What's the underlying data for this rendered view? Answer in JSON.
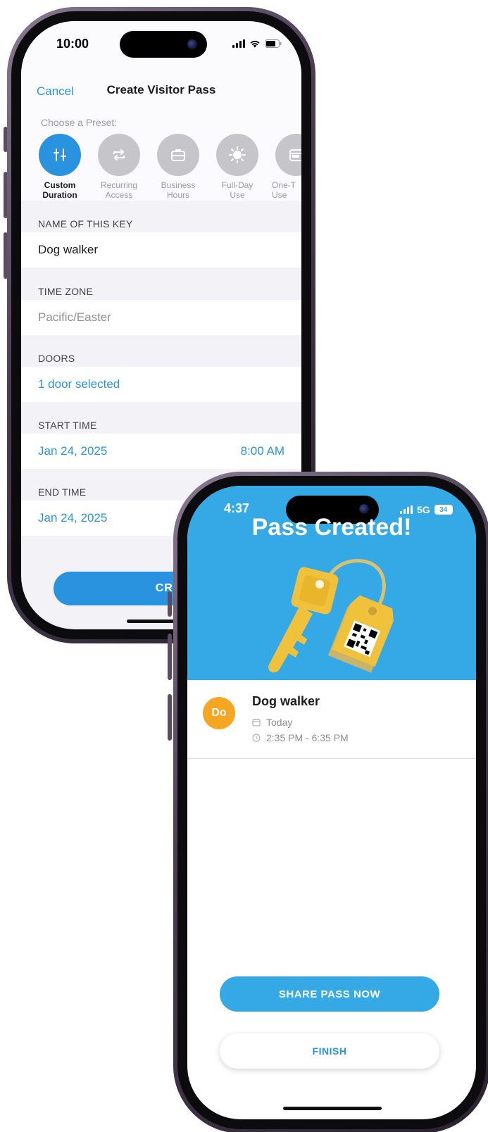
{
  "phone1": {
    "status": {
      "time": "10:00"
    },
    "nav": {
      "cancel": "Cancel",
      "title": "Create Visitor Pass"
    },
    "preset_label": "Choose a Preset:",
    "presets": [
      {
        "label": "Custom\nDuration",
        "icon": "sliders-icon",
        "active": true
      },
      {
        "label": "Recurring\nAccess",
        "icon": "repeat-icon",
        "active": false
      },
      {
        "label": "Business\nHours",
        "icon": "briefcase-icon",
        "active": false
      },
      {
        "label": "Full-Day\nUse",
        "icon": "sun-icon",
        "active": false
      },
      {
        "label": "One-T\nUse",
        "icon": "calendar-icon",
        "active": false
      }
    ],
    "sections": {
      "name_header": "NAME OF THIS KEY",
      "name_value": "Dog walker",
      "tz_header": "TIME ZONE",
      "tz_value": "Pacific/Easter",
      "doors_header": "DOORS",
      "doors_value": "1 door selected",
      "start_header": "START TIME",
      "start_date": "Jan 24, 2025",
      "start_time": "8:00 AM",
      "end_header": "END TIME",
      "end_date": "Jan 24, 2025"
    },
    "create_button": "CREATE"
  },
  "phone2": {
    "status": {
      "time": "4:37",
      "network": "5G",
      "battery": "34"
    },
    "title": "Pass Created!",
    "pass": {
      "avatar": "Do",
      "name": "Dog walker",
      "date": "Today",
      "time_range": "2:35 PM - 6:35 PM"
    },
    "share_button": "SHARE PASS NOW",
    "finish_button": "FINISH"
  },
  "colors": {
    "accent": "#2a93e0",
    "header_blue": "#35a9e6",
    "avatar": "#f5a622",
    "key_gold": "#f0c23c"
  }
}
